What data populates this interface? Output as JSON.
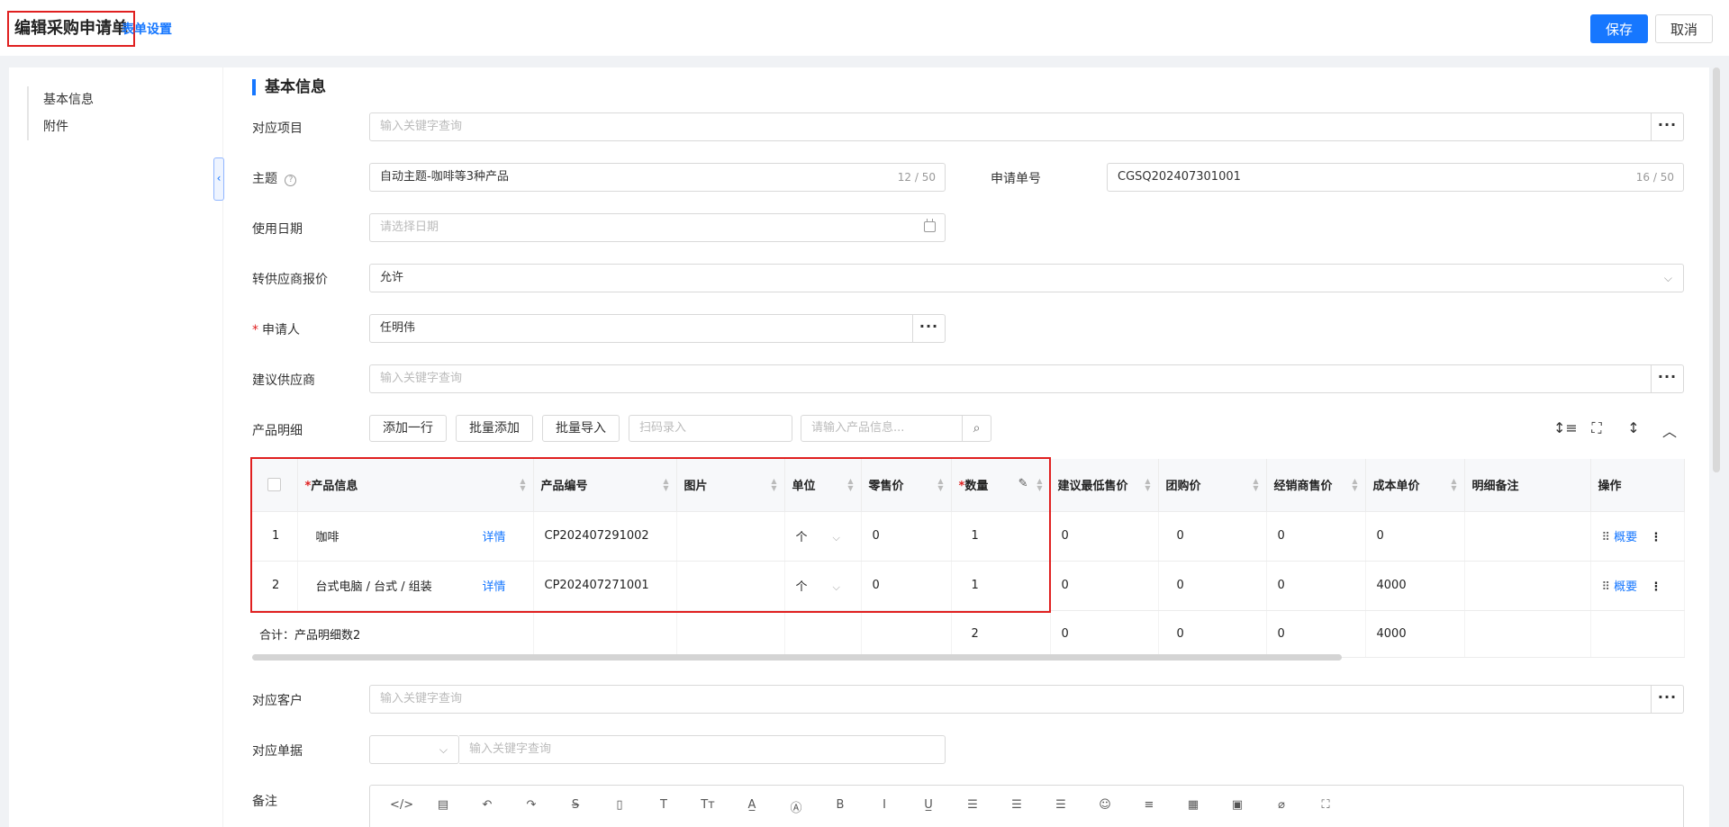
{
  "header": {
    "title": "编辑采购申请单",
    "form_settings": "表单设置",
    "save": "保存",
    "cancel": "取消"
  },
  "nav": {
    "items": [
      "基本信息",
      "附件"
    ]
  },
  "section_title": "基本信息",
  "form": {
    "project": {
      "label": "对应项目",
      "placeholder": "输入关键字查询"
    },
    "subject": {
      "label": "主题",
      "value": "自动主题-咖啡等3种产品",
      "counter": "12 / 50"
    },
    "order_no": {
      "label": "申请单号",
      "value": "CGSQ202407301001",
      "counter": "16 / 50"
    },
    "use_date": {
      "label": "使用日期",
      "placeholder": "请选择日期"
    },
    "supplier_quote": {
      "label": "转供应商报价",
      "value": "允许"
    },
    "applicant": {
      "label": "申请人",
      "value": "任明伟"
    },
    "suggest_supplier": {
      "label": "建议供应商",
      "placeholder": "输入关键字查询"
    },
    "product_detail": {
      "label": "产品明细"
    },
    "customer": {
      "label": "对应客户",
      "placeholder": "输入关键字查询"
    },
    "document": {
      "label": "对应单据",
      "placeholder": "输入关键字查询"
    },
    "remark": {
      "label": "备注"
    }
  },
  "toolbar": {
    "add_row": "添加一行",
    "batch_add": "批量添加",
    "batch_import": "批量导入",
    "scan_placeholder": "扫码录入",
    "search_placeholder": "请输入产品信息..."
  },
  "table": {
    "headers": {
      "product": "产品信息",
      "code": "产品编号",
      "image": "图片",
      "unit": "单位",
      "retail": "零售价",
      "qty": "数量",
      "min_price": "建议最低售价",
      "group_price": "团购价",
      "dealer_price": "经销商售价",
      "cost": "成本单价",
      "note": "明细备注",
      "ops": "操作"
    },
    "detail_link": "详情",
    "summary_link": "概要",
    "rows": [
      {
        "idx": "1",
        "product": "咖啡",
        "code": "CP202407291002",
        "unit": "个",
        "retail": "0",
        "qty": "1",
        "min_price": "0",
        "group_price": "0",
        "dealer_price": "0",
        "cost": "0"
      },
      {
        "idx": "2",
        "product": "台式电脑 / 台式 / 组装",
        "code": "CP202407271001",
        "unit": "个",
        "retail": "0",
        "qty": "1",
        "min_price": "0",
        "group_price": "0",
        "dealer_price": "0",
        "cost": "4000"
      }
    ],
    "summary": {
      "label": "合计：产品明细数2",
      "qty": "2",
      "min_price": "0",
      "group_price": "0",
      "dealer_price": "0",
      "cost": "4000"
    }
  },
  "colors": {
    "accent": "#1677ff",
    "highlight": "#e02020"
  }
}
